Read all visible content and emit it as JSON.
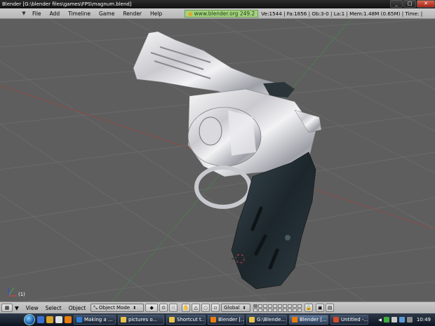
{
  "window": {
    "title": "Blender [G:\\blender files\\games\\FPS\\magnum.blend]",
    "minimize": "_",
    "maximize": "□",
    "close": "✕"
  },
  "menu": {
    "items": [
      "File",
      "Add",
      "Timeline",
      "Game",
      "Render",
      "Help"
    ],
    "website": "www.blender.org 249.2",
    "stats": "Ve:1544 | Fa:1856 | Ob:3-0 | La:1  | Mem:1.48M (0.65M)  | Time: |"
  },
  "viewport": {
    "frame_label": "(1)",
    "background": "#5e5e5e"
  },
  "header3d": {
    "view_label": "View",
    "select_label": "Select",
    "object_label": "Object",
    "mode": "Object Mode",
    "orientation": "Global"
  },
  "taskbar": {
    "tasks": [
      {
        "label": "Making a ...",
        "color": "#2d7fd4",
        "active": false
      },
      {
        "label": "pictures o...",
        "color": "#e9c34a",
        "active": false
      },
      {
        "label": "Shortcut t...",
        "color": "#e9c34a",
        "active": false
      },
      {
        "label": "Blender [...",
        "color": "#e87d0d",
        "active": false
      },
      {
        "label": "G:\\Blende...",
        "color": "#e9c34a",
        "active": false
      },
      {
        "label": "Blender [...",
        "color": "#e87d0d",
        "active": true
      },
      {
        "label": "Untitled -...",
        "color": "#d24a2a",
        "active": false
      }
    ],
    "clock": "10:49"
  },
  "colors": {
    "site_badge": "#a3d37f",
    "viewport_grid": "#6a6a6a",
    "gun_grip": "#1f2a30"
  }
}
